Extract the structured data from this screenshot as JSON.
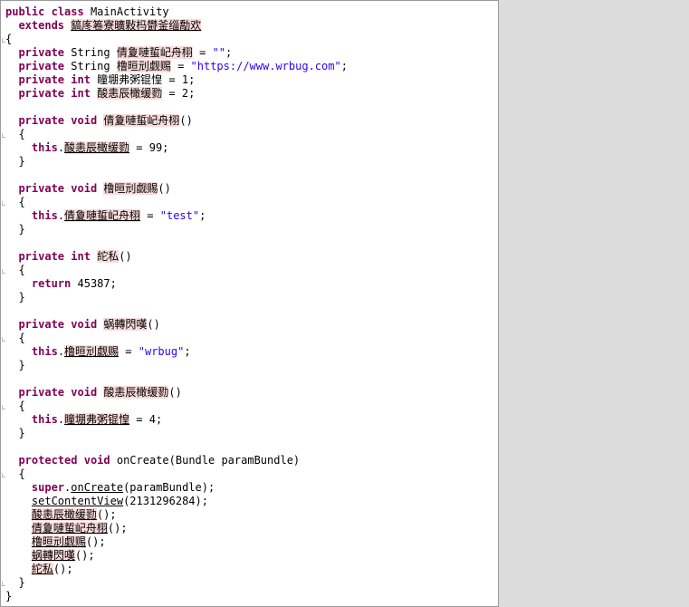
{
  "editor": {
    "lines": [
      {
        "segments": [
          {
            "t": "public",
            "c": "kw"
          },
          {
            "t": " "
          },
          {
            "t": "class",
            "c": "kw"
          },
          {
            "t": " MainActivity"
          }
        ]
      },
      {
        "segments": [
          {
            "t": "  "
          },
          {
            "t": "extends",
            "c": "kw"
          },
          {
            "t": " "
          },
          {
            "t": "鎬庝箞寮曠敤杩欎釜缁勪欢",
            "c": "ob ul"
          }
        ]
      },
      {
        "segments": [
          {
            "t": "{"
          }
        ]
      },
      {
        "segments": [
          {
            "t": "  "
          },
          {
            "t": "private",
            "c": "kw"
          },
          {
            "t": " String "
          },
          {
            "t": "倩夐嗹蜇屺舟栩",
            "c": "ob"
          },
          {
            "t": " = "
          },
          {
            "t": "\"\"",
            "c": "str"
          },
          {
            "t": ";"
          }
        ]
      },
      {
        "segments": [
          {
            "t": "  "
          },
          {
            "t": "private",
            "c": "kw"
          },
          {
            "t": " String "
          },
          {
            "t": "橹晅刓觑赐",
            "c": "ob"
          },
          {
            "t": " = "
          },
          {
            "t": "\"https://www.wrbug.com\"",
            "c": "str"
          },
          {
            "t": ";"
          }
        ]
      },
      {
        "segments": [
          {
            "t": "  "
          },
          {
            "t": "private",
            "c": "kw"
          },
          {
            "t": " "
          },
          {
            "t": "int",
            "c": "kw"
          },
          {
            "t": " 瞳堋弗粥锟惶 = 1;"
          }
        ]
      },
      {
        "segments": [
          {
            "t": "  "
          },
          {
            "t": "private",
            "c": "kw"
          },
          {
            "t": " "
          },
          {
            "t": "int",
            "c": "kw"
          },
          {
            "t": " "
          },
          {
            "t": "酸恚辰橄缓勠",
            "c": "ob"
          },
          {
            "t": " = 2;"
          }
        ]
      },
      {
        "segments": []
      },
      {
        "segments": [
          {
            "t": "  "
          },
          {
            "t": "private",
            "c": "kw"
          },
          {
            "t": " "
          },
          {
            "t": "void",
            "c": "kw"
          },
          {
            "t": " "
          },
          {
            "t": "倩夐嗹蜇屺舟栩",
            "c": "ob"
          },
          {
            "t": "()"
          }
        ]
      },
      {
        "segments": [
          {
            "t": "  {"
          }
        ]
      },
      {
        "segments": [
          {
            "t": "    "
          },
          {
            "t": "this",
            "c": "kw"
          },
          {
            "t": "."
          },
          {
            "t": "酸恚辰橄缓勠",
            "c": "ob ul"
          },
          {
            "t": " = 99;"
          }
        ]
      },
      {
        "segments": [
          {
            "t": "  }"
          }
        ]
      },
      {
        "segments": []
      },
      {
        "segments": [
          {
            "t": "  "
          },
          {
            "t": "private",
            "c": "kw"
          },
          {
            "t": " "
          },
          {
            "t": "void",
            "c": "kw"
          },
          {
            "t": " "
          },
          {
            "t": "橹晅刓觑赐",
            "c": "ob"
          },
          {
            "t": "()"
          }
        ]
      },
      {
        "segments": [
          {
            "t": "  {"
          }
        ]
      },
      {
        "segments": [
          {
            "t": "    "
          },
          {
            "t": "this",
            "c": "kw"
          },
          {
            "t": "."
          },
          {
            "t": "倩夐嗹蜇屺舟栩",
            "c": "ob ul"
          },
          {
            "t": " = "
          },
          {
            "t": "\"test\"",
            "c": "str"
          },
          {
            "t": ";"
          }
        ]
      },
      {
        "segments": [
          {
            "t": "  }"
          }
        ]
      },
      {
        "segments": []
      },
      {
        "segments": [
          {
            "t": "  "
          },
          {
            "t": "private",
            "c": "kw"
          },
          {
            "t": " "
          },
          {
            "t": "int",
            "c": "kw"
          },
          {
            "t": " "
          },
          {
            "t": "紽私",
            "c": "ob"
          },
          {
            "t": "()"
          }
        ]
      },
      {
        "segments": [
          {
            "t": "  {"
          }
        ]
      },
      {
        "segments": [
          {
            "t": "    "
          },
          {
            "t": "return",
            "c": "kw"
          },
          {
            "t": " 45387;"
          }
        ]
      },
      {
        "segments": [
          {
            "t": "  }"
          }
        ]
      },
      {
        "segments": []
      },
      {
        "segments": [
          {
            "t": "  "
          },
          {
            "t": "private",
            "c": "kw"
          },
          {
            "t": " "
          },
          {
            "t": "void",
            "c": "kw"
          },
          {
            "t": " "
          },
          {
            "t": "蜗轉閃嘆",
            "c": "ob"
          },
          {
            "t": "()"
          }
        ]
      },
      {
        "segments": [
          {
            "t": "  {"
          }
        ]
      },
      {
        "segments": [
          {
            "t": "    "
          },
          {
            "t": "this",
            "c": "kw"
          },
          {
            "t": "."
          },
          {
            "t": "橹晅刓觑赐",
            "c": "ob ul"
          },
          {
            "t": " = "
          },
          {
            "t": "\"wrbug\"",
            "c": "str"
          },
          {
            "t": ";"
          }
        ]
      },
      {
        "segments": [
          {
            "t": "  }"
          }
        ]
      },
      {
        "segments": []
      },
      {
        "segments": [
          {
            "t": "  "
          },
          {
            "t": "private",
            "c": "kw"
          },
          {
            "t": " "
          },
          {
            "t": "void",
            "c": "kw"
          },
          {
            "t": " "
          },
          {
            "t": "酸恚辰橄缓勠",
            "c": "ob"
          },
          {
            "t": "()"
          }
        ]
      },
      {
        "segments": [
          {
            "t": "  {"
          }
        ]
      },
      {
        "segments": [
          {
            "t": "    "
          },
          {
            "t": "this",
            "c": "kw"
          },
          {
            "t": "."
          },
          {
            "t": "瞳堋弗粥锟惶",
            "c": "ob ul"
          },
          {
            "t": " = 4;"
          }
        ]
      },
      {
        "segments": [
          {
            "t": "  }"
          }
        ]
      },
      {
        "segments": []
      },
      {
        "segments": [
          {
            "t": "  "
          },
          {
            "t": "protected",
            "c": "kw"
          },
          {
            "t": " "
          },
          {
            "t": "void",
            "c": "kw"
          },
          {
            "t": " onCreate(Bundle paramBundle)"
          }
        ]
      },
      {
        "segments": [
          {
            "t": "  {"
          }
        ]
      },
      {
        "segments": [
          {
            "t": "    "
          },
          {
            "t": "super",
            "c": "kw"
          },
          {
            "t": "."
          },
          {
            "t": "onCreate",
            "c": "ul"
          },
          {
            "t": "(paramBundle);"
          }
        ]
      },
      {
        "segments": [
          {
            "t": "    "
          },
          {
            "t": "setContentView",
            "c": "ul"
          },
          {
            "t": "(2131296284);"
          }
        ]
      },
      {
        "segments": [
          {
            "t": "    "
          },
          {
            "t": "酸恚辰橄缓勠",
            "c": "ob ul"
          },
          {
            "t": "();"
          }
        ]
      },
      {
        "segments": [
          {
            "t": "    "
          },
          {
            "t": "倩夐嗹蜇屺舟栩",
            "c": "ob ul"
          },
          {
            "t": "();"
          }
        ]
      },
      {
        "segments": [
          {
            "t": "    "
          },
          {
            "t": "橹晅刓觑赐",
            "c": "ob ul"
          },
          {
            "t": "();"
          }
        ]
      },
      {
        "segments": [
          {
            "t": "    "
          },
          {
            "t": "蜗轉閃嘆",
            "c": "ob ul"
          },
          {
            "t": "();"
          }
        ]
      },
      {
        "segments": [
          {
            "t": "    "
          },
          {
            "t": "紽私",
            "c": "ob ul"
          },
          {
            "t": "();"
          }
        ]
      },
      {
        "segments": [
          {
            "t": "  }"
          }
        ]
      },
      {
        "segments": [
          {
            "t": "}"
          }
        ]
      }
    ]
  },
  "colors": {
    "keyword": "#7f0055",
    "string": "#2a00ff",
    "obfuscated_highlight": "#f9dcdc",
    "background": "#ffffff",
    "side_panel": "#dcdcdc"
  }
}
